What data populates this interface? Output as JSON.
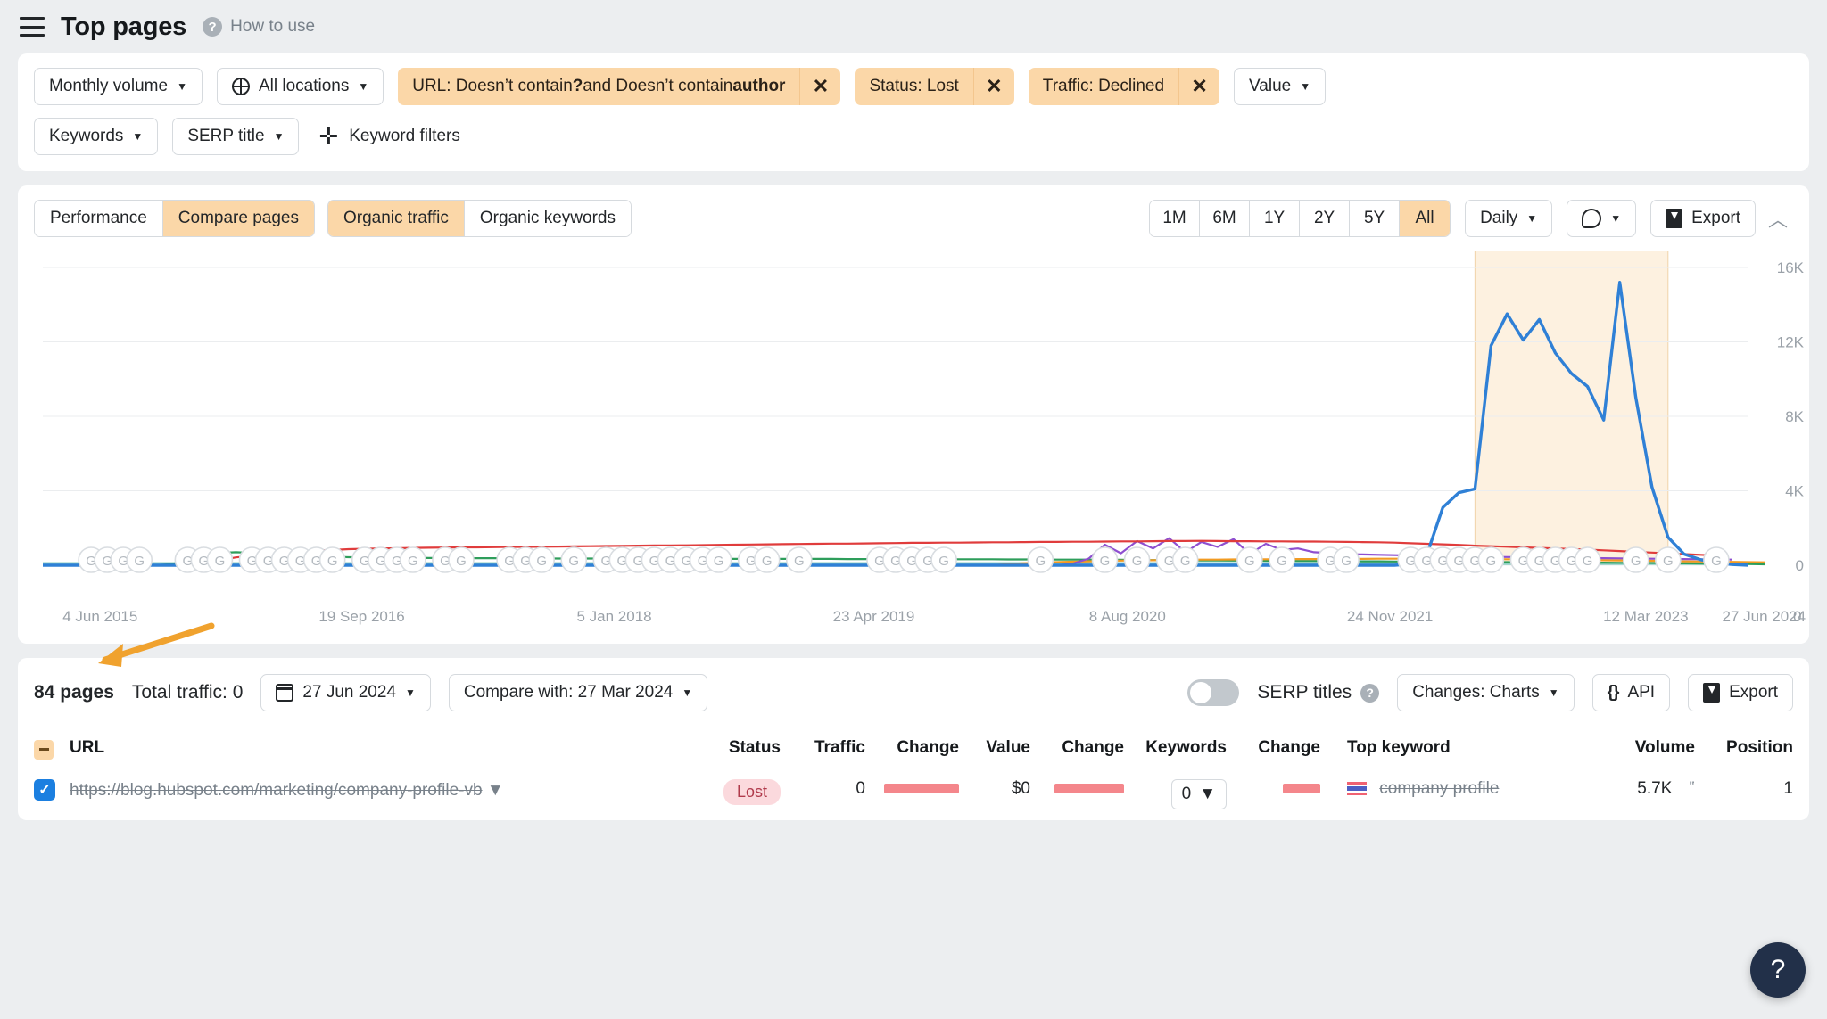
{
  "header": {
    "menu_icon": "hamburger-icon",
    "title": "Top pages",
    "help_link": "How to use"
  },
  "filters": {
    "volume_button": "Monthly volume",
    "locations_button": "All locations",
    "url_chip_prefix": "URL: Doesn’t contain ",
    "url_chip_b1": "?",
    "url_chip_mid": " and Doesn’t contain ",
    "url_chip_b2": "author",
    "status_chip": "Status: Lost",
    "traffic_chip": "Traffic: Declined",
    "value_button": "Value",
    "keywords_button": "Keywords",
    "serp_title_button": "SERP title",
    "add_filter": "Keyword filters",
    "close_label": "✕"
  },
  "chart_panel": {
    "tabs_left": [
      {
        "label": "Performance",
        "active": false
      },
      {
        "label": "Compare pages",
        "active": true
      }
    ],
    "tabs_right": [
      {
        "label": "Organic traffic",
        "active": true
      },
      {
        "label": "Organic keywords",
        "active": false
      }
    ],
    "ranges": [
      {
        "label": "1M",
        "active": false
      },
      {
        "label": "6M",
        "active": false
      },
      {
        "label": "1Y",
        "active": false
      },
      {
        "label": "2Y",
        "active": false
      },
      {
        "label": "5Y",
        "active": false
      },
      {
        "label": "All",
        "active": true
      }
    ],
    "granularity": "Daily",
    "export": "Export",
    "collapse_icon": "chevron-up-icon"
  },
  "chart_data": {
    "type": "line",
    "title": "",
    "xlabel": "",
    "ylabel": "",
    "ylim": [
      0,
      16000
    ],
    "grid": true,
    "legend": "none",
    "y_ticks": [
      "0",
      "4K",
      "8K",
      "12K",
      "16K"
    ],
    "y_tick_values": [
      0,
      4000,
      8000,
      12000,
      16000
    ],
    "x_ticks": [
      "4 Jun 2015",
      "19 Sep 2016",
      "5 Jan 2018",
      "23 Apr 2019",
      "8 Aug 2020",
      "24 Nov 2021",
      "12 Mar 2023",
      "27 Jun 2024"
    ],
    "highlight_band": {
      "from": "approx Apr 2024",
      "to": "27 Jun 2024",
      "color": "#fdf1e0"
    },
    "series": [
      {
        "name": "blue-page",
        "color": "#2f80d6",
        "values": [
          0,
          0,
          0,
          0,
          0,
          0,
          0,
          0,
          0,
          0,
          0,
          0,
          0,
          0,
          0,
          0,
          0,
          0,
          0,
          0,
          0,
          0,
          0,
          0,
          0,
          0,
          0,
          0,
          0,
          0,
          0,
          0,
          0,
          0,
          0,
          0,
          0,
          0,
          0,
          0,
          0,
          0,
          0,
          0,
          0,
          0,
          0,
          0,
          0,
          0,
          0,
          0,
          0,
          0,
          0,
          0,
          0,
          0,
          0,
          0,
          0,
          0,
          0,
          0,
          0,
          0,
          0,
          0,
          0,
          0,
          0,
          0,
          0,
          0,
          0,
          0,
          0,
          0,
          0,
          0,
          0,
          0,
          0,
          0,
          0,
          60,
          520,
          3100,
          3900,
          4100,
          11800,
          13500,
          12100,
          13200,
          11400,
          10300,
          9600,
          7800,
          15200,
          9000,
          4200,
          1500,
          600,
          300,
          120,
          40,
          0
        ]
      },
      {
        "name": "red-page",
        "color": "#e03c3c",
        "values": [
          0,
          0,
          0,
          0,
          0,
          0,
          0,
          0,
          0,
          0,
          80,
          260,
          420,
          500,
          620,
          700,
          760,
          800,
          820,
          860,
          880,
          900,
          910,
          930,
          940,
          950,
          960,
          960,
          970,
          980,
          980,
          990,
          1000,
          1010,
          1020,
          1030,
          1040,
          1050,
          1060,
          1060,
          1070,
          1080,
          1090,
          1100,
          1110,
          1120,
          1130,
          1140,
          1150,
          1160,
          1160,
          1170,
          1180,
          1190,
          1200,
          1200,
          1210,
          1210,
          1220,
          1230,
          1230,
          1240,
          1250,
          1250,
          1260,
          1260,
          1270,
          1280,
          1280,
          1290,
          1300,
          1300,
          1310,
          1300,
          1290,
          1290,
          1280,
          1280,
          1270,
          1270,
          1260,
          1250,
          1240,
          1230,
          1210,
          1180,
          1150,
          1120,
          1090,
          1050,
          1020,
          990,
          960,
          930,
          900,
          870,
          840,
          800,
          760,
          720,
          680,
          640,
          600,
          560,
          520
        ]
      },
      {
        "name": "green-page",
        "color": "#2e9e5b",
        "values": [
          0,
          0,
          0,
          0,
          0,
          0,
          0,
          0,
          60,
          260,
          520,
          660,
          700,
          660,
          600,
          540,
          500,
          470,
          450,
          430,
          420,
          410,
          400,
          400,
          390,
          390,
          380,
          380,
          380,
          370,
          370,
          370,
          360,
          360,
          360,
          360,
          350,
          350,
          350,
          350,
          350,
          350,
          350,
          340,
          340,
          340,
          340,
          340,
          340,
          340,
          330,
          330,
          330,
          330,
          330,
          330,
          320,
          320,
          320,
          320,
          310,
          310,
          310,
          300,
          300,
          300,
          290,
          290,
          280,
          280,
          270,
          270,
          260,
          260,
          250,
          250,
          240,
          240,
          230,
          230,
          220,
          220,
          210,
          210,
          200,
          200,
          190,
          190,
          180,
          180,
          170,
          170,
          160,
          160,
          150,
          150,
          140,
          140,
          130,
          130,
          120,
          110,
          100,
          90,
          80,
          70,
          60,
          50
        ]
      },
      {
        "name": "purple-page",
        "color": "#8e4fd0",
        "values": [
          0,
          0,
          0,
          0,
          0,
          0,
          0,
          0,
          0,
          0,
          0,
          0,
          0,
          0,
          0,
          0,
          0,
          0,
          0,
          0,
          0,
          0,
          0,
          0,
          0,
          0,
          0,
          0,
          0,
          0,
          0,
          0,
          0,
          0,
          0,
          0,
          0,
          0,
          0,
          0,
          0,
          0,
          0,
          0,
          0,
          0,
          0,
          0,
          0,
          0,
          0,
          0,
          0,
          0,
          0,
          0,
          0,
          0,
          0,
          0,
          0,
          0,
          0,
          0,
          80,
          360,
          1100,
          640,
          1300,
          900,
          1450,
          700,
          1250,
          980,
          1400,
          600,
          1150,
          820,
          900,
          700,
          650,
          600,
          580,
          560,
          540,
          520,
          500,
          480,
          470,
          460,
          450,
          440,
          430,
          420,
          410,
          400,
          390,
          380,
          370,
          360,
          350,
          340,
          330,
          320,
          310,
          300
        ]
      },
      {
        "name": "orange-page",
        "color": "#f29b22",
        "values": [
          0,
          0,
          0,
          0,
          0,
          0,
          0,
          0,
          0,
          0,
          0,
          0,
          0,
          0,
          0,
          0,
          0,
          0,
          0,
          0,
          0,
          0,
          0,
          0,
          0,
          0,
          0,
          0,
          0,
          0,
          0,
          0,
          0,
          0,
          0,
          0,
          0,
          0,
          0,
          0,
          0,
          0,
          0,
          0,
          0,
          0,
          0,
          0,
          0,
          0,
          0,
          0,
          0,
          0,
          0,
          0,
          0,
          0,
          0,
          0,
          60,
          110,
          140,
          170,
          190,
          210,
          230,
          250,
          260,
          270,
          280,
          290,
          300,
          300,
          310,
          310,
          320,
          320,
          330,
          330,
          340,
          340,
          340,
          350,
          350,
          350,
          350,
          340,
          340,
          330,
          330,
          320,
          320,
          310,
          300,
          290,
          280,
          270,
          260,
          250,
          240,
          230,
          210,
          200,
          190,
          180,
          170,
          160
        ]
      },
      {
        "name": "teal-baseline",
        "color": "#8fd0c4",
        "values": [
          90,
          90,
          90,
          90,
          90,
          90,
          90,
          90,
          90,
          90,
          90,
          90,
          90,
          90,
          90,
          90,
          90,
          90,
          90,
          90,
          90,
          90,
          90,
          90,
          90,
          90,
          90,
          90,
          90,
          90,
          90,
          90,
          90,
          90,
          90,
          90,
          90,
          90,
          90,
          90,
          90,
          90,
          90,
          90,
          90,
          90,
          90,
          90,
          90,
          90,
          90,
          90,
          90,
          90,
          90,
          90,
          90,
          90,
          90,
          90,
          90,
          90,
          90,
          90,
          90,
          90,
          90,
          90,
          90,
          90,
          90,
          90,
          90,
          90,
          90,
          90,
          90,
          90,
          90,
          90,
          90,
          90,
          90,
          90,
          90,
          90,
          90,
          90,
          90,
          90,
          90,
          90,
          90,
          90,
          90,
          90,
          90,
          90,
          90,
          90,
          90,
          90,
          90,
          90,
          90,
          90,
          90,
          90
        ]
      }
    ],
    "update_markers": {
      "label": "G",
      "count": 78,
      "note": "Google algorithm update pins along the zero baseline"
    }
  },
  "table_toolbar": {
    "pages_count": "84 pages",
    "total_traffic": "Total traffic: 0",
    "date": "27 Jun 2024",
    "compare_with": "Compare with: 27 Mar 2024",
    "serp_titles": "SERP titles",
    "changes": "Changes: Charts",
    "api": "API",
    "export": "Export"
  },
  "table": {
    "columns": [
      "URL",
      "Status",
      "Traffic",
      "Change",
      "Value",
      "Change",
      "Keywords",
      "Change",
      "Top keyword",
      "Volume",
      "Position"
    ],
    "rows": [
      {
        "checked": true,
        "url": "https://blog.hubspot.com/marketing/company-profile-vb",
        "status": "Lost",
        "traffic": "0",
        "traffic_change": "",
        "value": "$0",
        "value_change": "",
        "keywords": "0",
        "keywords_change": "",
        "top_keyword": "company profile",
        "top_keyword_flag": "thailand-flag",
        "volume": "5.7K",
        "position": "1"
      }
    ]
  },
  "fab": {
    "label": "?"
  },
  "colors": {
    "accent": "#fbd7a8",
    "blue": "#2f80d6",
    "red": "#e03c3c",
    "green": "#2e9e5b",
    "purple": "#8e4fd0",
    "orange": "#f29b22"
  }
}
